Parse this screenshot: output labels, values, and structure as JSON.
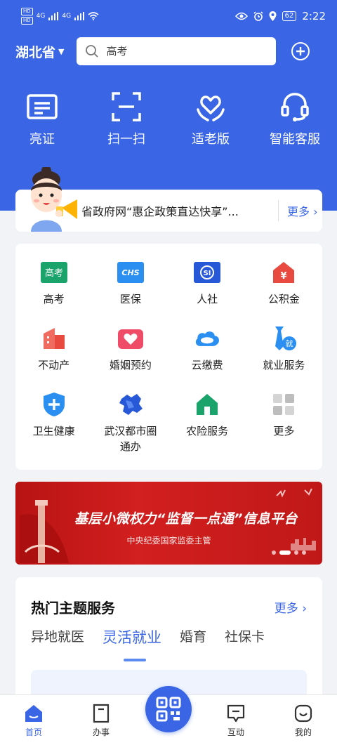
{
  "status_bar": {
    "sim1": "HD",
    "sim2": "HD",
    "net1": "4G",
    "net2": "4G",
    "battery": "62",
    "time": "2:22"
  },
  "topbar": {
    "province": "湖北省",
    "search_placeholder": "高考"
  },
  "quick_actions": [
    {
      "label": "亮证",
      "icon": "id-card-icon"
    },
    {
      "label": "扫一扫",
      "icon": "scan-icon"
    },
    {
      "label": "适老版",
      "icon": "elder-heart-icon"
    },
    {
      "label": "智能客服",
      "icon": "headset-icon"
    }
  ],
  "notice": {
    "text": "省政府网“惠企政策直达快享”...",
    "more": "更多"
  },
  "services": [
    {
      "label": "高考",
      "icon": "gaokao-icon",
      "color": "#1aa36b"
    },
    {
      "label": "医保",
      "icon": "chs-icon",
      "color": "#2a8ff0"
    },
    {
      "label": "人社",
      "icon": "si-icon",
      "color": "#2758d8"
    },
    {
      "label": "公积金",
      "icon": "house-fund-icon",
      "color": "#e84a3f"
    },
    {
      "label": "不动产",
      "icon": "building-icon",
      "color": "#e84a3f"
    },
    {
      "label": "婚姻预约",
      "icon": "marriage-icon",
      "color": "#ef4c68"
    },
    {
      "label": "云缴费",
      "icon": "cloud-icon",
      "color": "#2a8ff0"
    },
    {
      "label": "就业服务",
      "icon": "employment-icon",
      "color": "#2a8ff0"
    },
    {
      "label": "卫生健康",
      "icon": "health-shield-icon",
      "color": "#2a8ff0"
    },
    {
      "label": "武汉都市圈\n通办",
      "icon": "map-icon",
      "color": "#2758d8"
    },
    {
      "label": "农险服务",
      "icon": "farm-house-icon",
      "color": "#1aa36b"
    },
    {
      "label": "更多",
      "icon": "more-grid-icon",
      "color": "#c8c8c8"
    }
  ],
  "banner": {
    "title": "基层小微权力“监督一点通”信息平台",
    "subtitle": "中央纪委国家监委主管"
  },
  "hot_services": {
    "title": "热门主题服务",
    "more": "更多",
    "tabs": [
      "异地就医",
      "灵活就业",
      "婚育",
      "社保卡"
    ],
    "active_tab": 1
  },
  "tabbar": {
    "items": [
      {
        "label": "首页",
        "icon": "home-icon"
      },
      {
        "label": "办事",
        "icon": "document-icon"
      },
      {
        "label": "",
        "icon": "qr-scan-icon"
      },
      {
        "label": "互动",
        "icon": "chat-icon"
      },
      {
        "label": "我的",
        "icon": "profile-icon"
      }
    ],
    "active": 0
  },
  "colors": {
    "brand_blue": "#3a66e6",
    "banner_red": "#c01818"
  }
}
